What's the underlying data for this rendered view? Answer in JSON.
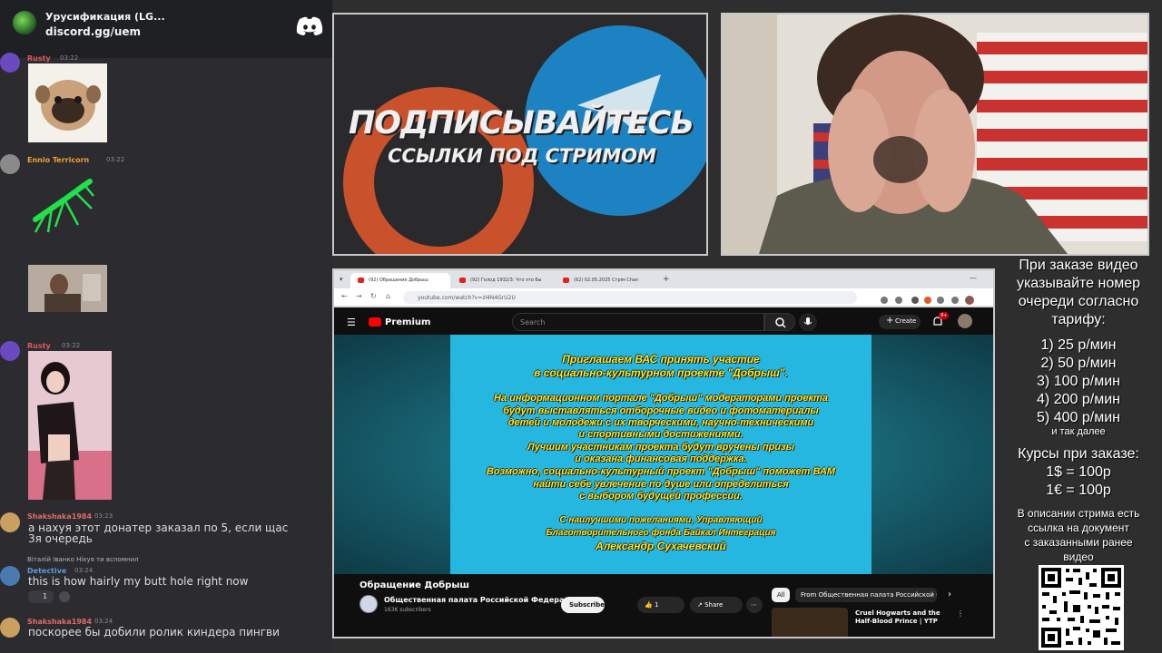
{
  "discord": {
    "server_name": "Урусификация (LG...",
    "invite": "discord.gg/uem",
    "messages": [
      {
        "author": "Rusty",
        "time": "03:22",
        "color": "#f04747",
        "type": "image"
      },
      {
        "author": "Ennio Terricorn",
        "time": "03:22",
        "color": "#f0a030",
        "type": "image"
      },
      {
        "author": "",
        "time": "",
        "type": "image"
      },
      {
        "author": "Rusty",
        "time": "03:22",
        "color": "#f04747",
        "type": "image"
      },
      {
        "author": "Shakshaka1984",
        "time": "03:23",
        "color": "#e06a6a",
        "text": "а нахуя этот донатер заказал по 5, если щас 3я очередь"
      },
      {
        "reply": "Віталій Іванко Ніхуя ти вспомнил",
        "author": "Detective",
        "time": "03:24",
        "color": "#5b8fe0",
        "text": "this is how hairly my butt hole right now",
        "reaction_count": "1"
      },
      {
        "author": "Shakshaka1984",
        "time": "03:24",
        "color": "#e06a6a",
        "text": "поскорее бы добили ролик киндера пингви"
      }
    ]
  },
  "banner": {
    "line1": "ПОДПИСЫВАЙТЕСЬ",
    "line2": "ССЫЛКИ ПОД СТРИМОМ"
  },
  "browser": {
    "tabs": [
      {
        "label": "(92) Обращение Добрыш"
      },
      {
        "label": "(92) Голод 1932/3: Что это бы"
      },
      {
        "label": "(62) 02.05.2025 Стрім Chan"
      }
    ],
    "url": "youtube.com/watch?v=zl4N4GrU2U",
    "yt_brand": "Premium",
    "search_placeholder": "Search",
    "create_label": "Create",
    "notif_count": "9+",
    "slide_lines": [
      "Приглашаем ВАС принять участие",
      "в социально-культурном проекте \"Добрыш\".",
      "На информационном портале \"Добрыш\" модераторами проекта",
      "будут выставляться отборочные видео и фотоматериалы",
      "детей и молодежи с их творческими, научно-техническими",
      "и спортивными достижениями.",
      "Лучшим участникам проекта будут вручены призы",
      "и оказана финансовая поддержка.",
      "Возможно, социально-культурный проект \"Добрыш\" поможет ВАМ",
      "найти себе увлечение по душе или определиться",
      "с выбором будущей профессии.",
      "С наилучшими пожеланиями, Управляющий",
      "Благотворительного фонда Байкал Интеграция",
      "Александр Сухачевский"
    ],
    "video_title": "Обращение Добрыш",
    "channel_name": "Общественная палата Российской Федерации",
    "subs": "163K subscribers",
    "subscribe": "Subscribe",
    "likes": "1",
    "share": "Share",
    "chip_all": "All",
    "chip_from": "From Общественная палата Российской Фе",
    "rec_title": "Cruel Hogwarts and the Half-Blood Prince | YTP"
  },
  "info_panel": {
    "lines": [
      "При заказе видео",
      "указывайте номер",
      "очереди согласно",
      "тарифу:",
      "1) 25 р/мин",
      "2) 50 р/мин",
      "3) 100 р/мин",
      "4) 200 р/мин",
      "5) 400 р/мин",
      "и так далее",
      "Курсы при заказе:",
      "1$ = 100р",
      "1€ = 100р",
      "В описании стрима есть",
      "ссылка на документ",
      "с заказанными ранее",
      "видео"
    ]
  }
}
